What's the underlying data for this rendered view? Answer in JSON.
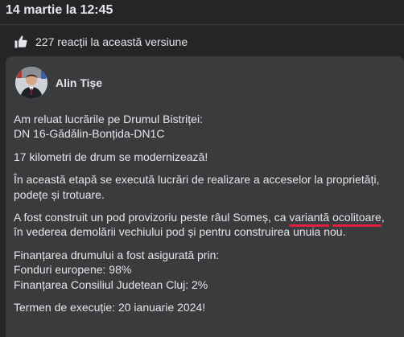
{
  "header": {
    "date": "14 martie la 12:45"
  },
  "reactions": {
    "icon": "thumbs-up-icon",
    "text": "227 reacții la această versiune"
  },
  "post": {
    "author": "Alin Tișe",
    "avatar_icon": "author-avatar",
    "paragraphs": {
      "p1_line1": "Am reluat lucrările pe Drumul Bistriței:",
      "p1_line2": "DN 16-Gădălin-Bonțida-DN1C",
      "p2": "17 kilometri de drum se modernizează!",
      "p3": "În această etapă se execută lucrări de realizare a acceselor la proprietăți, podețe și trotuare.",
      "p4_before": "A fost construit un pod provizoriu peste râul Someș, ca ",
      "p4_mark1": "variantă",
      "p4_space": " ",
      "p4_mark2": "ocolitoare",
      "p4_after": ", în vederea demolării vechiului pod și pentru construirea unuia nou.",
      "p5_line1": "Finanțarea drumului a fost asigurată prin:",
      "p5_line2": "Fonduri europene: 98%",
      "p5_line3": "Finanțarea Consiliul Judetean Cluj: 2%",
      "p6": "Termen de execuție: 20 ianuarie 2024!"
    }
  },
  "colors": {
    "background": "#242526",
    "card": "#3a3b3c",
    "text": "#e4e6eb",
    "underline": "#e41e3f"
  }
}
